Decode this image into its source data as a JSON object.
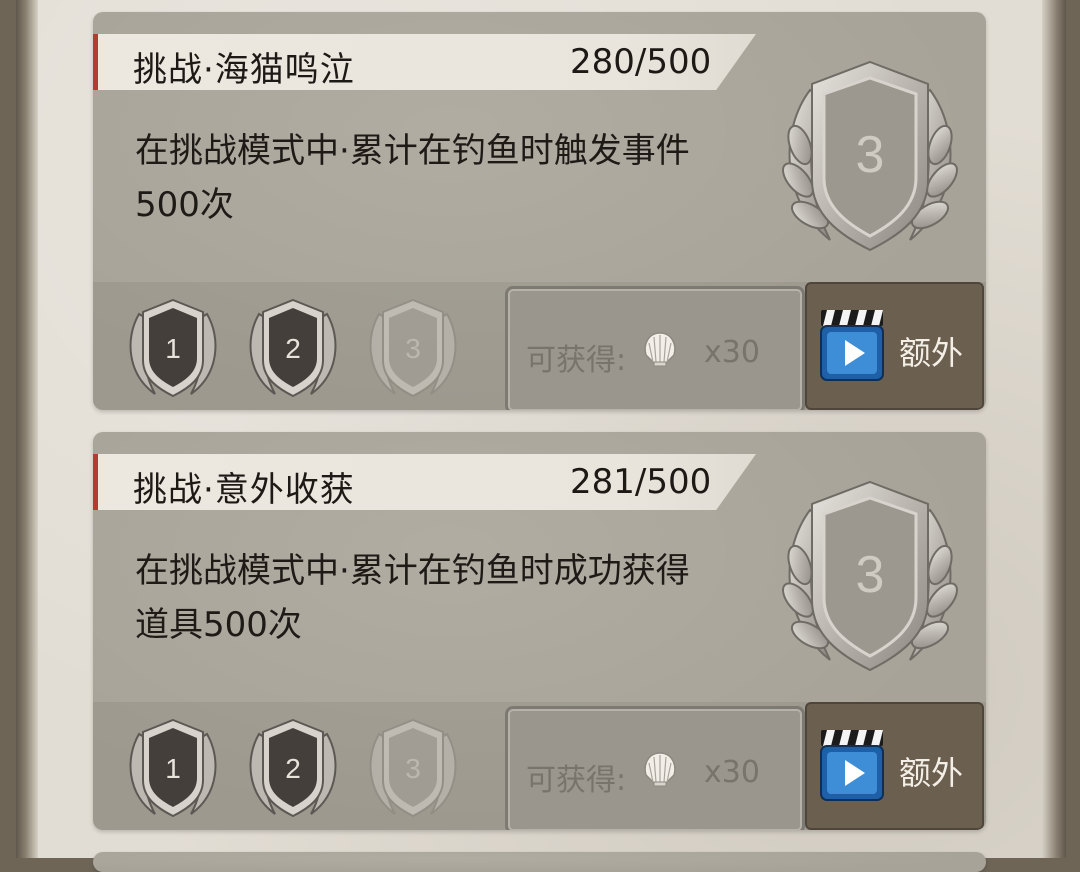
{
  "achievements": [
    {
      "title": "挑战·海猫鸣泣",
      "progress": "280/500",
      "desc_line1": "在挑战模式中·累计在钓鱼时触发事件",
      "desc_line2": "500次",
      "current_tier": "3",
      "tiers": [
        "1",
        "2",
        "3"
      ],
      "tiers_unlocked": [
        true,
        true,
        false
      ],
      "reward_label": "可获得:",
      "reward_icon": "shell-icon",
      "reward_count": "x30",
      "extra_label": "额外"
    },
    {
      "title": "挑战·意外收获",
      "progress": "281/500",
      "desc_line1": "在挑战模式中·累计在钓鱼时成功获得",
      "desc_line2": "道具500次",
      "current_tier": "3",
      "tiers": [
        "1",
        "2",
        "3"
      ],
      "tiers_unlocked": [
        true,
        true,
        false
      ],
      "reward_label": "可获得:",
      "reward_icon": "shell-icon",
      "reward_count": "x30",
      "extra_label": "额外"
    }
  ],
  "colors": {
    "accent_red": "#b23b33",
    "medal_silver": "#c9c6c0",
    "medal_dark": "#4a4440",
    "extra_button": "#6b5f4f"
  }
}
